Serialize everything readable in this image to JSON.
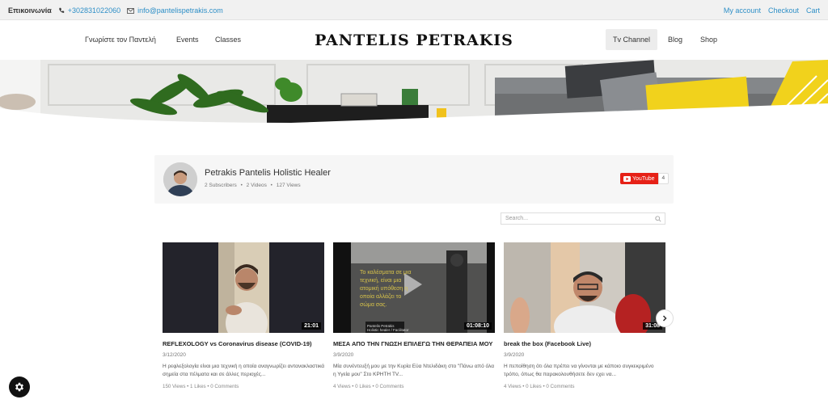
{
  "topbar": {
    "label": "Επικοινωνία",
    "phone": "+302831022060",
    "email": "info@pantelispetrakis.com",
    "links": [
      "My account",
      "Checkout",
      "Cart"
    ]
  },
  "header": {
    "nav_left": [
      "Γνωρίστε τον Παντελή",
      "Events",
      "Classes"
    ],
    "brand": "PANTELIS PETRAKIS",
    "nav_right": [
      "Tv Channel",
      "Blog",
      "Shop"
    ]
  },
  "channel": {
    "name": "Petrakis Pantelis Holistic Healer",
    "subscribers": "2 Subscribers",
    "videos": "2 Videos",
    "views": "127 Views",
    "youtube_label": "YouTube",
    "youtube_count": "4"
  },
  "search": {
    "placeholder": "Search..."
  },
  "videos": [
    {
      "title": "REFLEXOLOGY vs Coronavirus disease (COVID-19)",
      "duration": "21:01",
      "date": "3/12/2020",
      "desc": "Η ρεφλεξολογία είναι μια τεχνική η οποία αναγνωρίζει αντανακλαστικά σημεία στα πέλματα και σε άλλες περιοχές...",
      "views": "150 Views",
      "likes": "1 Likes",
      "comments": "0 Comments"
    },
    {
      "title": "ΜΕΣΑ ΑΠΟ ΤΗΝ ΓΝΩΣΗ ΕΠΙΛΕΓΩ ΤΗΝ ΘΕΡΑΠΕΙΑ ΜΟΥ",
      "duration": "01:08:10",
      "date": "3/9/2020",
      "desc": "Μία συνέντευξή μου με την Κυρία Εύα Ντελιδάκη στο \"Πάνω από όλα η Υγεία μου\" Στο ΚΡΗΤΗ TV...",
      "views": "4 Views",
      "likes": "0 Likes",
      "comments": "0 Comments",
      "overlay_text": "Το καλέσματα σε μια τεχνική, είναι μια ατομική υπόθεση η οποία αλλάζει το σώμα σας.",
      "overlay_caption": "Pantelis Petrakis",
      "overlay_caption2": "Holistic healer / Facilitator"
    },
    {
      "title": "break the box (Facebook Live)",
      "duration": "31:08",
      "date": "3/9/2020",
      "desc": "Η πεποίθηση ότι όλα πρέπει να γίνονται με κάποιο συγκεκριμένο τρόπο, όπως θα παρακολουθήσετε δεν εχει να...",
      "views": "4 Views",
      "likes": "0 Likes",
      "comments": "0 Comments"
    }
  ],
  "icons": {
    "phone": "phone-icon",
    "email": "envelope-icon",
    "youtube": "youtube-icon",
    "search": "search-icon",
    "next": "chevron-right-icon",
    "settings": "gear-icon"
  },
  "colors": {
    "link": "#2e8fc7",
    "youtube": "#e62117",
    "accent_yellow": "#f1d21c"
  }
}
